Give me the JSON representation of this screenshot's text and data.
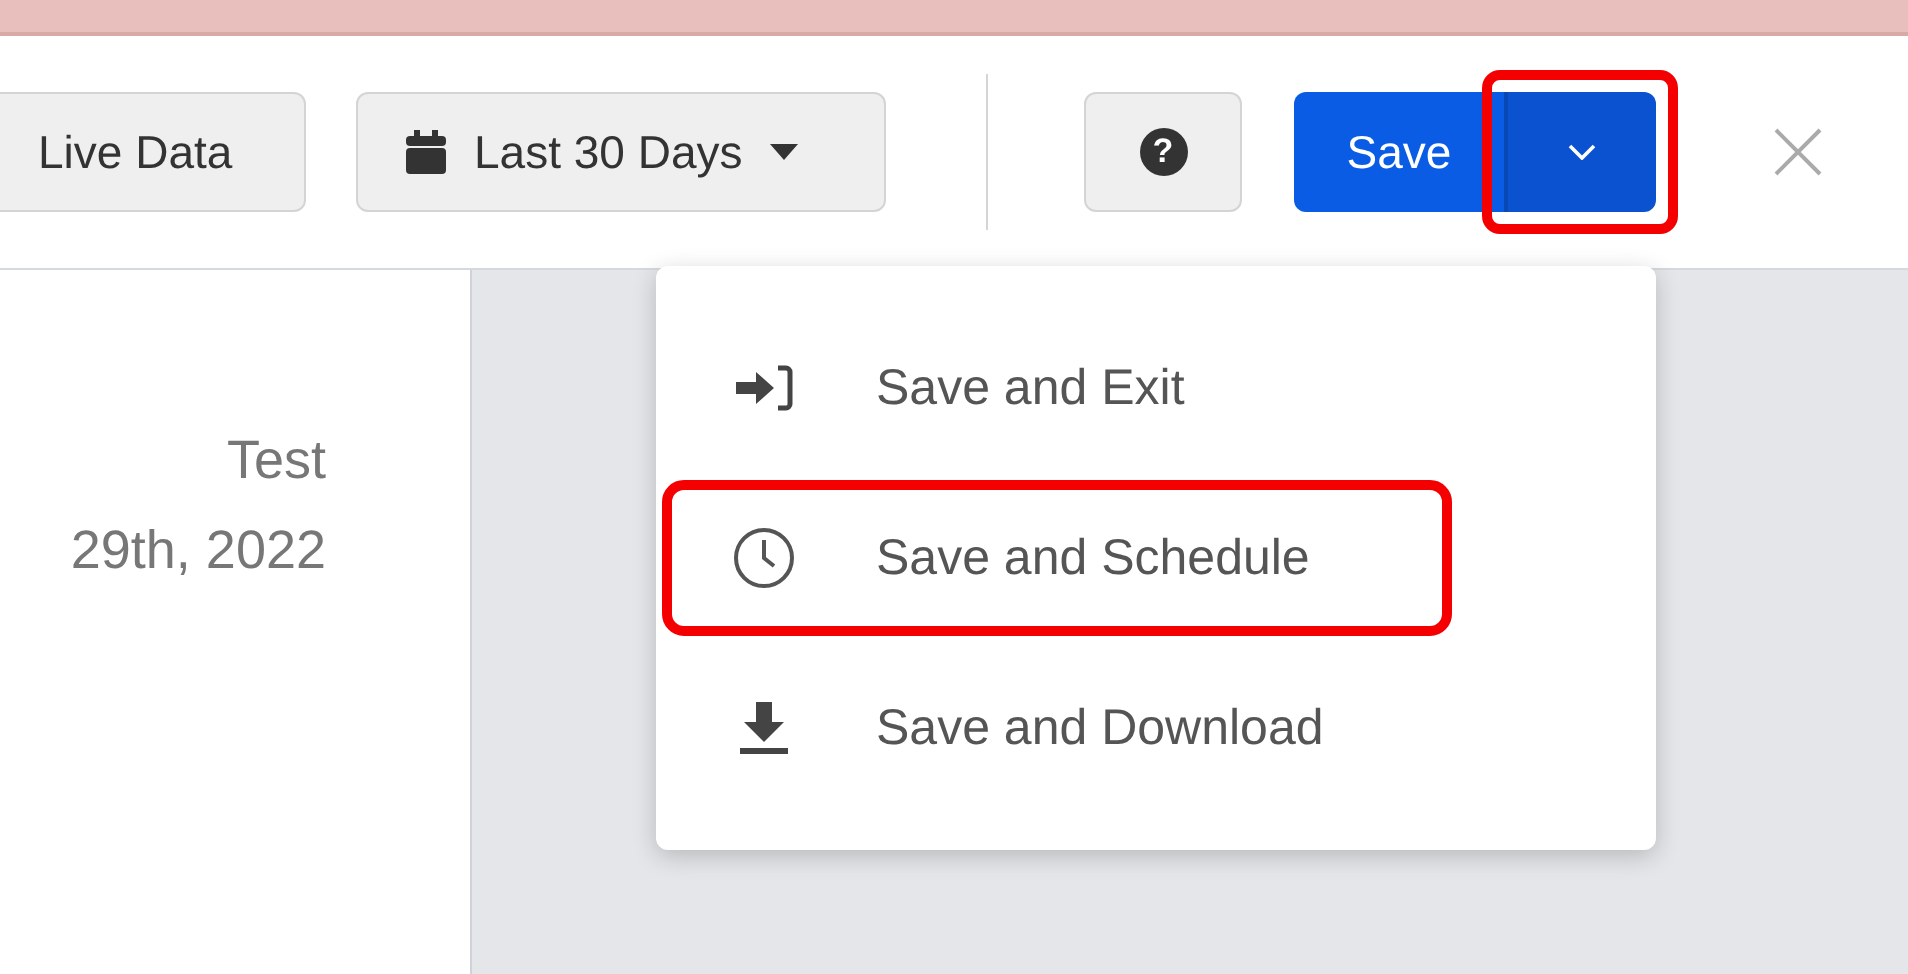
{
  "toolbar": {
    "live_button": "Live Data",
    "date_button": {
      "label": "Last 30 Days"
    },
    "help_button": "?",
    "save_button": "Save",
    "save_menu_toggle": {
      "expanded": true,
      "highlighted": true
    }
  },
  "report": {
    "title": "Test",
    "date": "29th, 2022"
  },
  "save_menu": [
    {
      "kind": "exit",
      "label": "Save and Exit",
      "highlighted": false
    },
    {
      "kind": "schedule",
      "label": "Save and Schedule",
      "highlighted": true
    },
    {
      "kind": "download",
      "label": "Save and Download",
      "highlighted": false
    }
  ]
}
